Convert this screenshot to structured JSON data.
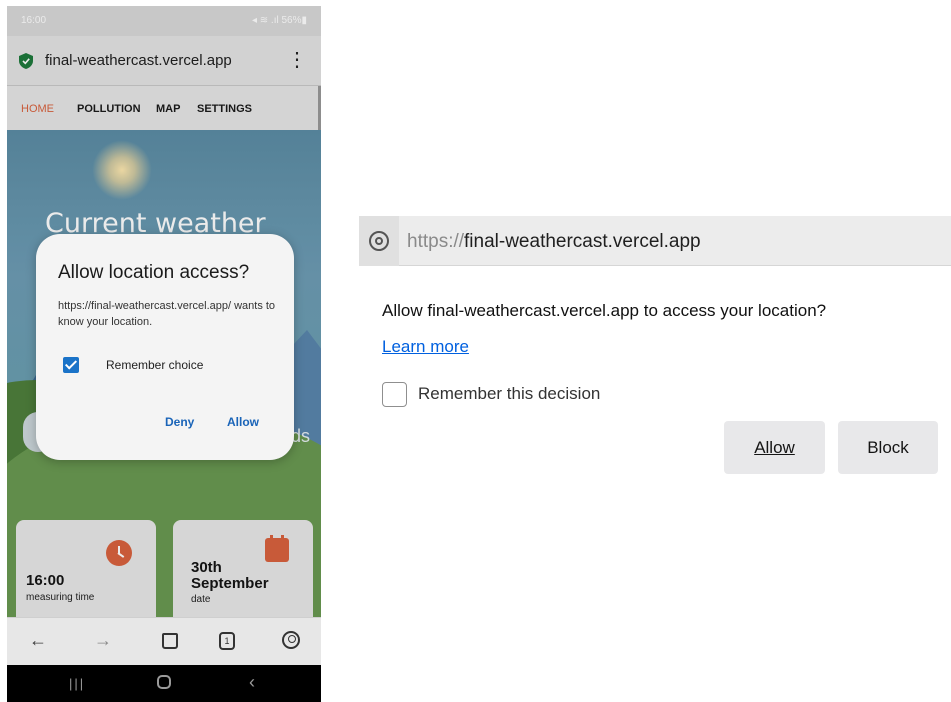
{
  "phone": {
    "status_bar": {
      "time": "16:00",
      "icons": "◂ ≋ .ıl 56%▮"
    },
    "url_bar": {
      "url": "final-weathercast.vercel.app",
      "menu_glyph": "⋮"
    },
    "nav": {
      "items": [
        "HOME",
        "POLLUTION",
        "MAP",
        "SETTINGS"
      ]
    },
    "hero": {
      "title": "Current weather",
      "partial_text": "ds"
    },
    "cards": [
      {
        "value": "16:00",
        "caption": "measuring time",
        "icon": "clock-icon"
      },
      {
        "value_line1": "30th",
        "value_line2": "September",
        "caption": "date",
        "icon": "calendar-icon"
      }
    ],
    "toolbar": {
      "back": "←",
      "forward": "→",
      "tab_count": "1"
    },
    "system_nav": {
      "recents": "|||",
      "back": "‹"
    },
    "dialog": {
      "title": "Allow location access?",
      "body": "https://final-weathercast.vercel.app/ wants to know your location.",
      "checkbox_label": "Remember choice",
      "checkbox_checked": true,
      "deny_label": "Deny",
      "allow_label": "Allow"
    },
    "colors": {
      "accent": "#d9623e",
      "dialog_button": "#1a64b8",
      "checkbox": "#1a73c8"
    }
  },
  "desktop": {
    "address": {
      "scheme": "https://",
      "host": "final-weathercast.vercel.app"
    },
    "message": "Allow final-weathercast.vercel.app to access your location?",
    "learn_more": "Learn more",
    "remember_label": "Remember this decision",
    "remember_checked": false,
    "allow_label": "Allow",
    "block_label": "Block",
    "colors": {
      "link": "#0060df",
      "button_bg": "#e8e8ea"
    }
  }
}
